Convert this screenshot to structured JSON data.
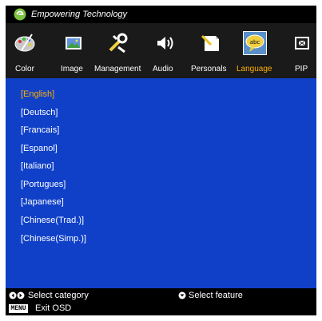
{
  "header": {
    "brand": "Empowering Technology"
  },
  "categories": [
    {
      "label": "Color",
      "icon": "color-icon"
    },
    {
      "label": "Image",
      "icon": "image-icon"
    },
    {
      "label": "Management",
      "icon": "management-icon"
    },
    {
      "label": "Audio",
      "icon": "audio-icon"
    },
    {
      "label": "Personals",
      "icon": "personals-icon"
    },
    {
      "label": "Language",
      "icon": "language-icon",
      "active": true
    },
    {
      "label": "PIP",
      "icon": "pip-icon"
    }
  ],
  "languages": [
    {
      "label": "[English]",
      "selected": true
    },
    {
      "label": "[Deutsch]"
    },
    {
      "label": "[Francais]"
    },
    {
      "label": "[Espanol]"
    },
    {
      "label": "[Italiano]"
    },
    {
      "label": "[Portugues]"
    },
    {
      "label": "[Japanese]"
    },
    {
      "label": "[Chinese(Trad.)]"
    },
    {
      "label": "[Chinese(Simp.)]"
    }
  ],
  "footer": {
    "select_category": "Select category",
    "select_feature": "Select feature",
    "menu_key": "MENU",
    "exit_osd": "Exit OSD"
  },
  "colors": {
    "active_label": "#ffb000",
    "content_bg": "#1040c8",
    "category_bg": "#1a1a1a"
  }
}
